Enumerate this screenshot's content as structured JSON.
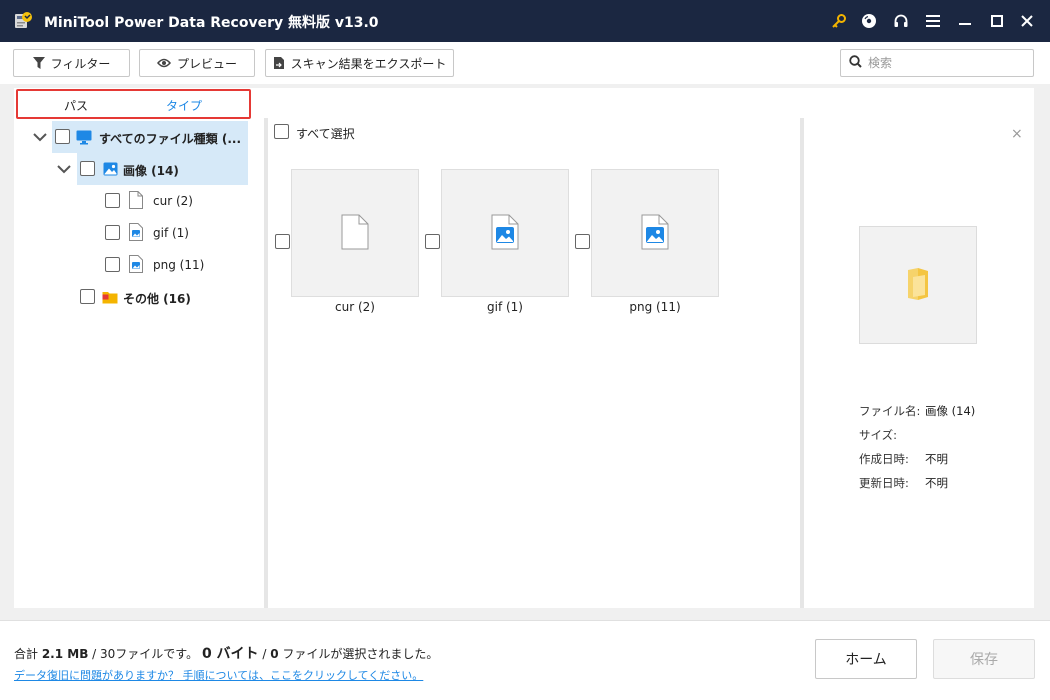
{
  "window": {
    "title": "MiniTool Power Data Recovery 無料版 v13.0",
    "icons": [
      "key-icon",
      "disc-icon",
      "headset-icon",
      "menu-icon",
      "minimize-icon",
      "maximize-icon",
      "close-icon"
    ],
    "accent_color": "#1b2741"
  },
  "toolbar": {
    "filter_label": "フィルター",
    "preview_label": "プレビュー",
    "export_label": "スキャン結果をエクスポート",
    "search_placeholder": "検索"
  },
  "tabs": {
    "path_label": "パス",
    "type_label": "タイプ",
    "active": "タイプ",
    "highlight_color": "#e53935"
  },
  "tree": {
    "root": {
      "label": "すべてのファイル種類 (...",
      "icon": "monitor-icon"
    },
    "images": {
      "label": "画像 (14)",
      "icon": "image-icon"
    },
    "children": [
      {
        "label": "cur (2)",
        "icon": "blank-file-icon"
      },
      {
        "label": "gif (1)",
        "icon": "image-file-icon"
      },
      {
        "label": "png (11)",
        "icon": "image-file-icon"
      }
    ],
    "other": {
      "label": "その他 (16)",
      "icon": "folder-icon"
    }
  },
  "content": {
    "select_all_label": "すべて選択",
    "items": [
      {
        "label": "cur (2)",
        "icon": "blank-file-icon"
      },
      {
        "label": "gif (1)",
        "icon": "image-file-icon"
      },
      {
        "label": "png (11)",
        "icon": "image-file-icon"
      }
    ]
  },
  "preview": {
    "close_label": "×",
    "filename_label": "ファイル名:",
    "filename_value": "画像 (14)",
    "size_label": "サイズ:",
    "size_value": "",
    "created_label": "作成日時:",
    "created_value": "不明",
    "modified_label": "更新日時:",
    "modified_value": "不明"
  },
  "footer": {
    "total_prefix": "合計 ",
    "total_size": "2.1 MB",
    "total_files": " / 30ファイルです。",
    "selected_bytes": "0 バイト",
    "selected_sep": " / ",
    "selected_files": "0",
    "selected_suffix": " ファイルが選択されました。",
    "help_link": "データ復旧に問題がありますか？ 手順については、ここをクリックしてください。",
    "home_label": "ホーム",
    "save_label": "保存"
  }
}
